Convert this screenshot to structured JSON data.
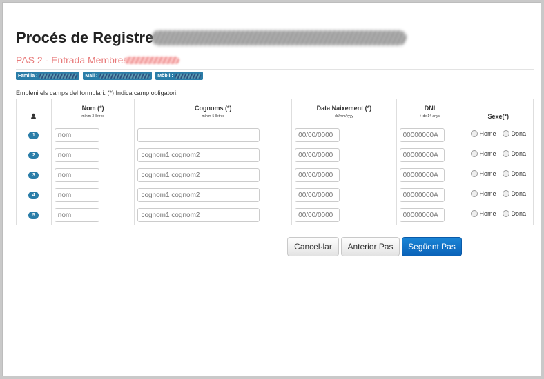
{
  "page": {
    "title": "Procés de Registre",
    "step": "PAS 2 - Entrada Membres",
    "badges": [
      {
        "label": "Familia :"
      },
      {
        "label": "Mail :"
      },
      {
        "label": "Mòbil :"
      }
    ],
    "instructions": "Empleni els camps del formulari. (*) Indica camp obligatori."
  },
  "table": {
    "headers": {
      "person_icon": "person-icon",
      "nom": "Nom (*)",
      "nom_sub": "-mínim 3 lletres-",
      "cognoms": "Cognoms (*)",
      "cognoms_sub": "-mínim 5 lletres-",
      "data": "Data Naixement (*)",
      "data_sub": "dd/mm/yyyy",
      "dni": "DNI",
      "dni_sub": "+ de 14 anys",
      "sexe": "Sexe(*)"
    },
    "placeholders": {
      "nom": "nom",
      "cognoms": "cognom1 cognom2",
      "data": "00/00/0000",
      "dni": "00000000A"
    },
    "rows": [
      {
        "num": "1",
        "cognoms_placeholder": ""
      },
      {
        "num": "2",
        "cognoms_placeholder": "cognom1 cognom2"
      },
      {
        "num": "3",
        "cognoms_placeholder": "cognom1 cognom2"
      },
      {
        "num": "4",
        "cognoms_placeholder": "cognom1 cognom2"
      },
      {
        "num": "5",
        "cognoms_placeholder": "cognom1 cognom2"
      }
    ],
    "sex_options": {
      "home": "Home",
      "dona": "Dona"
    }
  },
  "buttons": {
    "cancel": "Cancel·lar",
    "previous": "Anterior Pas",
    "next": "Següent Pas"
  },
  "colors": {
    "accent": "#2a7da8",
    "step_text": "#e87a7a",
    "primary_button": "#0a62b8"
  }
}
